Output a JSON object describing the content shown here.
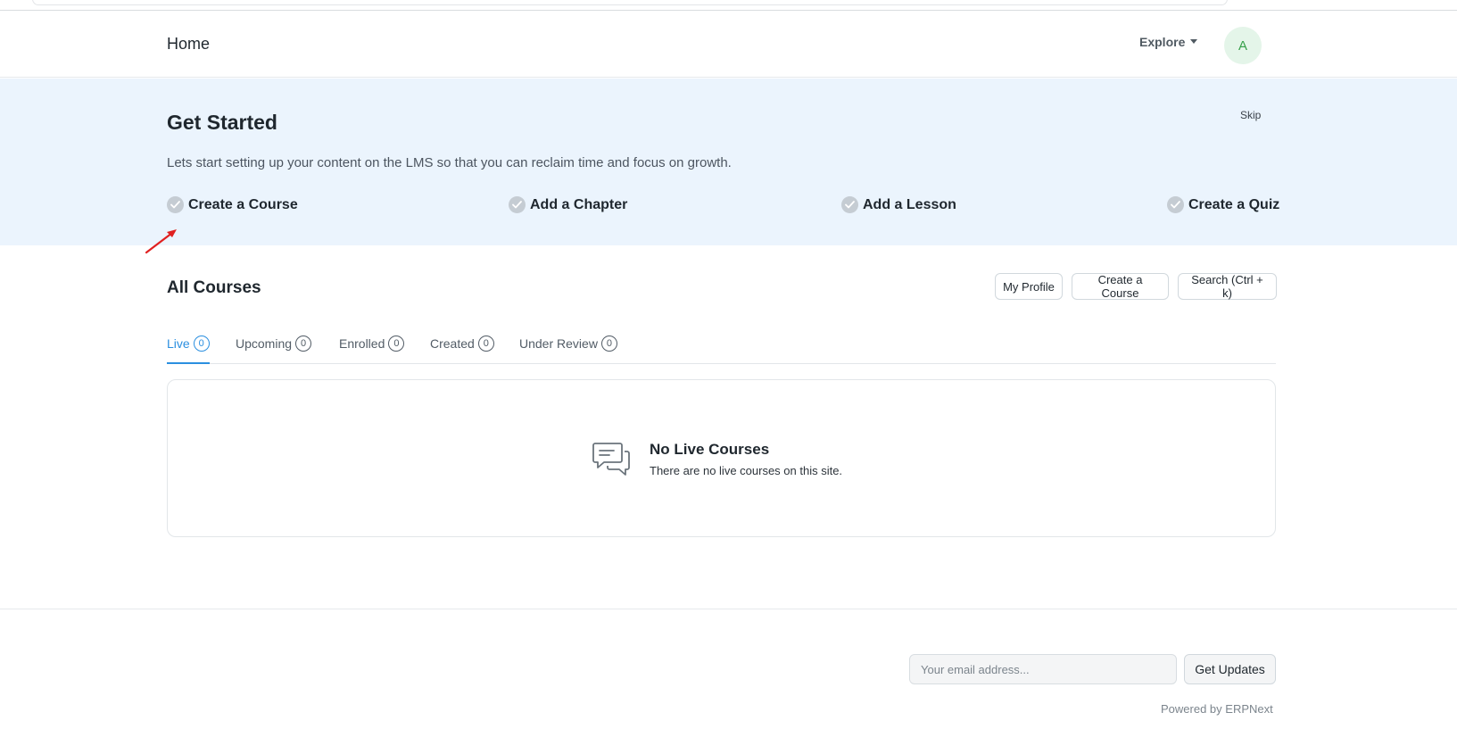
{
  "navbar": {
    "brand": "Home",
    "explore_label": "Explore",
    "avatar_initial": "A"
  },
  "banner": {
    "title": "Get Started",
    "skip_label": "Skip",
    "description": "Lets start setting up your content on the LMS so that you can reclaim time and focus on growth.",
    "steps": [
      {
        "label": "Create a Course"
      },
      {
        "label": "Add a Chapter"
      },
      {
        "label": "Add a Lesson"
      },
      {
        "label": "Create a Quiz"
      }
    ]
  },
  "courses": {
    "title": "All Courses",
    "buttons": {
      "my_profile": "My Profile",
      "create_course": "Create a Course",
      "search": "Search (Ctrl + k)"
    },
    "tabs": [
      {
        "label": "Live",
        "count": "0",
        "active": true
      },
      {
        "label": "Upcoming",
        "count": "0"
      },
      {
        "label": "Enrolled",
        "count": "0"
      },
      {
        "label": "Created",
        "count": "0"
      },
      {
        "label": "Under Review",
        "count": "0"
      }
    ],
    "empty_state": {
      "icon": "chat-bubbles-icon",
      "title": "No Live Courses",
      "description": "There are no live courses on this site."
    }
  },
  "footer": {
    "email_placeholder": "Your email address...",
    "email_value": "",
    "get_updates_label": "Get Updates",
    "powered_by_prefix": "Powered by",
    "powered_by_link": "ERPNext"
  },
  "colors": {
    "accent": "#2b8fe0",
    "banner_bg": "#ebf4fd",
    "avatar_bg": "#e4f5e9",
    "avatar_text": "#36a04a",
    "annotation_arrow": "#e02020"
  }
}
